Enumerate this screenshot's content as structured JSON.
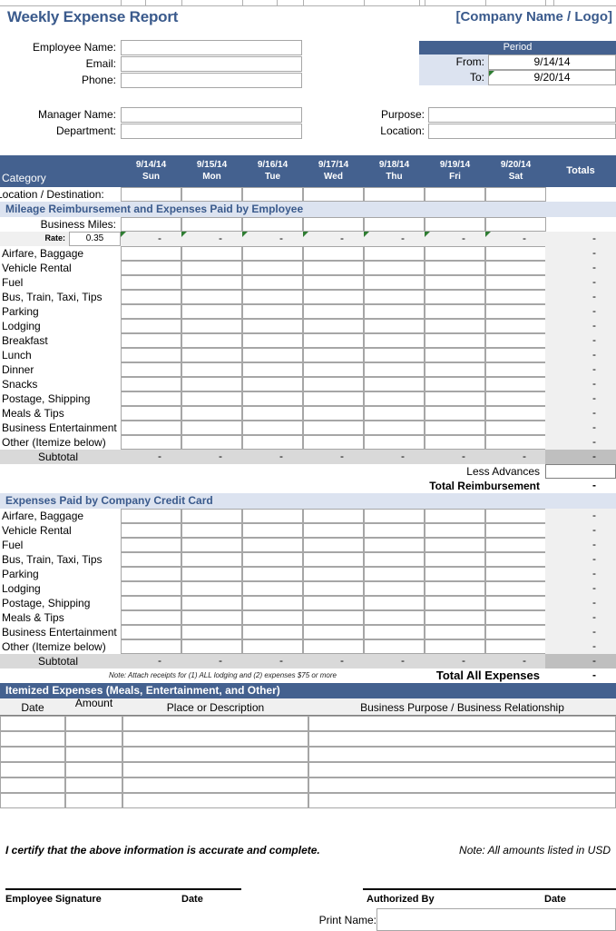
{
  "header": {
    "title": "Weekly Expense Report",
    "company": "[Company Name / Logo]"
  },
  "employee_info": {
    "fields": [
      {
        "label": "Employee Name:",
        "value": ""
      },
      {
        "label": "Email:",
        "value": ""
      },
      {
        "label": "Phone:",
        "value": ""
      }
    ],
    "fields2": [
      {
        "label": "Manager Name:",
        "value": ""
      },
      {
        "label": "Department:",
        "value": ""
      }
    ]
  },
  "trip_info": {
    "fields": [
      {
        "label": "Purpose:",
        "value": ""
      },
      {
        "label": "Location:",
        "value": ""
      }
    ]
  },
  "period": {
    "title": "Period",
    "from_label": "From:",
    "from_value": "9/14/14",
    "to_label": "To:",
    "to_value": "9/20/14"
  },
  "grid": {
    "category_header": "Category",
    "totals_header": "Totals",
    "days": [
      {
        "date": "9/14/14",
        "dow": "Sun"
      },
      {
        "date": "9/15/14",
        "dow": "Mon"
      },
      {
        "date": "9/16/14",
        "dow": "Tue"
      },
      {
        "date": "9/17/14",
        "dow": "Wed"
      },
      {
        "date": "9/18/14",
        "dow": "Thu"
      },
      {
        "date": "9/19/14",
        "dow": "Fri"
      },
      {
        "date": "9/20/14",
        "dow": "Sat"
      }
    ],
    "location_row_label": "Location / Destination:",
    "dash": "-"
  },
  "employee_section": {
    "band": "Mileage Reimbursement and Expenses Paid by Employee",
    "business_miles_label": "Business Miles:",
    "rate_label": "Rate:",
    "rate_value": "0.35",
    "categories": [
      "Airfare, Baggage",
      "Vehicle Rental",
      "Fuel",
      "Bus, Train, Taxi, Tips",
      "Parking",
      "Lodging",
      "Breakfast",
      "Lunch",
      "Dinner",
      "Snacks",
      "Postage, Shipping",
      "Meals & Tips",
      "Business Entertainment",
      "Other (Itemize below)"
    ],
    "subtotal_label": "Subtotal",
    "less_advances_label": "Less Advances",
    "total_reimbursement_label": "Total Reimbursement"
  },
  "creditcard_section": {
    "band": "Expenses Paid by Company Credit Card",
    "categories": [
      "Airfare, Baggage",
      "Vehicle Rental",
      "Fuel",
      "Bus, Train, Taxi, Tips",
      "Parking",
      "Lodging",
      "Postage, Shipping",
      "Meals & Tips",
      "Business Entertainment",
      "Other (Itemize below)"
    ],
    "subtotal_label": "Subtotal",
    "receipt_note": "Note:  Attach receipts for (1) ALL lodging and (2) expenses $75 or more",
    "total_all_label": "Total All Expenses"
  },
  "itemized": {
    "band": "Itemized Expenses (Meals, Entertainment, and Other)",
    "columns": [
      "Date",
      "Amount",
      "Place or Description",
      "Business Purpose / Business Relationship"
    ],
    "row_count": 6
  },
  "footer": {
    "certify": "I certify that the above information is accurate and complete.",
    "usd_note": "Note: All amounts listed in USD",
    "employee_signature_label": "Employee Signature",
    "employee_date_label": "Date",
    "authorized_by_label": "Authorized By",
    "authorized_date_label": "Date",
    "print_name_label": "Print Name:"
  },
  "colors": {
    "header_blue": "#44618f",
    "band_blue": "#dce3f0",
    "title_blue": "#3a5a8c",
    "subtotal_gray": "#d9d9d9",
    "totals_gray": "#f0f0f0"
  }
}
